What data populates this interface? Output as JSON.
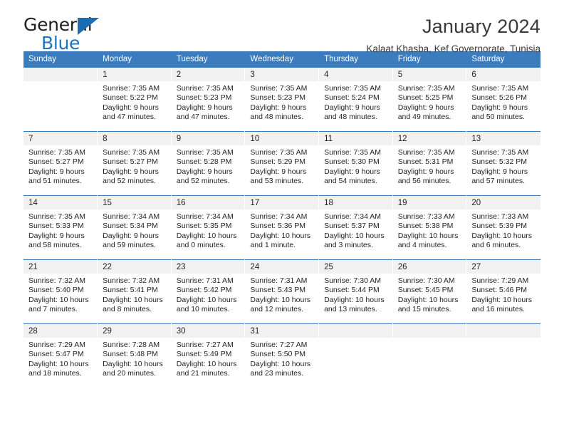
{
  "brand": {
    "name_line1": "General",
    "name_line2": "Blue",
    "triangle_color": "#1b6cb0",
    "blue_text_color": "#1b74bc"
  },
  "header": {
    "title": "January 2024",
    "subtitle": "Kalaat Khasba, Kef Governorate, Tunisia"
  },
  "theme": {
    "header_blue": "#3a7cbe",
    "daynum_band": "#f1f1f1",
    "text": "#231f20"
  },
  "columns": [
    "Sunday",
    "Monday",
    "Tuesday",
    "Wednesday",
    "Thursday",
    "Friday",
    "Saturday"
  ],
  "labels": {
    "sunrise_prefix": "Sunrise:",
    "sunset_prefix": "Sunset:",
    "daylight_prefix": "Daylight:"
  },
  "weeks": [
    [
      {
        "day": "",
        "sunrise": "",
        "sunset": "",
        "daylight_line1": "",
        "daylight_line2": ""
      },
      {
        "day": "1",
        "sunrise": "Sunrise: 7:35 AM",
        "sunset": "Sunset: 5:22 PM",
        "daylight_line1": "Daylight: 9 hours",
        "daylight_line2": "and 47 minutes."
      },
      {
        "day": "2",
        "sunrise": "Sunrise: 7:35 AM",
        "sunset": "Sunset: 5:23 PM",
        "daylight_line1": "Daylight: 9 hours",
        "daylight_line2": "and 47 minutes."
      },
      {
        "day": "3",
        "sunrise": "Sunrise: 7:35 AM",
        "sunset": "Sunset: 5:23 PM",
        "daylight_line1": "Daylight: 9 hours",
        "daylight_line2": "and 48 minutes."
      },
      {
        "day": "4",
        "sunrise": "Sunrise: 7:35 AM",
        "sunset": "Sunset: 5:24 PM",
        "daylight_line1": "Daylight: 9 hours",
        "daylight_line2": "and 48 minutes."
      },
      {
        "day": "5",
        "sunrise": "Sunrise: 7:35 AM",
        "sunset": "Sunset: 5:25 PM",
        "daylight_line1": "Daylight: 9 hours",
        "daylight_line2": "and 49 minutes."
      },
      {
        "day": "6",
        "sunrise": "Sunrise: 7:35 AM",
        "sunset": "Sunset: 5:26 PM",
        "daylight_line1": "Daylight: 9 hours",
        "daylight_line2": "and 50 minutes."
      }
    ],
    [
      {
        "day": "7",
        "sunrise": "Sunrise: 7:35 AM",
        "sunset": "Sunset: 5:27 PM",
        "daylight_line1": "Daylight: 9 hours",
        "daylight_line2": "and 51 minutes."
      },
      {
        "day": "8",
        "sunrise": "Sunrise: 7:35 AM",
        "sunset": "Sunset: 5:27 PM",
        "daylight_line1": "Daylight: 9 hours",
        "daylight_line2": "and 52 minutes."
      },
      {
        "day": "9",
        "sunrise": "Sunrise: 7:35 AM",
        "sunset": "Sunset: 5:28 PM",
        "daylight_line1": "Daylight: 9 hours",
        "daylight_line2": "and 52 minutes."
      },
      {
        "day": "10",
        "sunrise": "Sunrise: 7:35 AM",
        "sunset": "Sunset: 5:29 PM",
        "daylight_line1": "Daylight: 9 hours",
        "daylight_line2": "and 53 minutes."
      },
      {
        "day": "11",
        "sunrise": "Sunrise: 7:35 AM",
        "sunset": "Sunset: 5:30 PM",
        "daylight_line1": "Daylight: 9 hours",
        "daylight_line2": "and 54 minutes."
      },
      {
        "day": "12",
        "sunrise": "Sunrise: 7:35 AM",
        "sunset": "Sunset: 5:31 PM",
        "daylight_line1": "Daylight: 9 hours",
        "daylight_line2": "and 56 minutes."
      },
      {
        "day": "13",
        "sunrise": "Sunrise: 7:35 AM",
        "sunset": "Sunset: 5:32 PM",
        "daylight_line1": "Daylight: 9 hours",
        "daylight_line2": "and 57 minutes."
      }
    ],
    [
      {
        "day": "14",
        "sunrise": "Sunrise: 7:35 AM",
        "sunset": "Sunset: 5:33 PM",
        "daylight_line1": "Daylight: 9 hours",
        "daylight_line2": "and 58 minutes."
      },
      {
        "day": "15",
        "sunrise": "Sunrise: 7:34 AM",
        "sunset": "Sunset: 5:34 PM",
        "daylight_line1": "Daylight: 9 hours",
        "daylight_line2": "and 59 minutes."
      },
      {
        "day": "16",
        "sunrise": "Sunrise: 7:34 AM",
        "sunset": "Sunset: 5:35 PM",
        "daylight_line1": "Daylight: 10 hours",
        "daylight_line2": "and 0 minutes."
      },
      {
        "day": "17",
        "sunrise": "Sunrise: 7:34 AM",
        "sunset": "Sunset: 5:36 PM",
        "daylight_line1": "Daylight: 10 hours",
        "daylight_line2": "and 1 minute."
      },
      {
        "day": "18",
        "sunrise": "Sunrise: 7:34 AM",
        "sunset": "Sunset: 5:37 PM",
        "daylight_line1": "Daylight: 10 hours",
        "daylight_line2": "and 3 minutes."
      },
      {
        "day": "19",
        "sunrise": "Sunrise: 7:33 AM",
        "sunset": "Sunset: 5:38 PM",
        "daylight_line1": "Daylight: 10 hours",
        "daylight_line2": "and 4 minutes."
      },
      {
        "day": "20",
        "sunrise": "Sunrise: 7:33 AM",
        "sunset": "Sunset: 5:39 PM",
        "daylight_line1": "Daylight: 10 hours",
        "daylight_line2": "and 6 minutes."
      }
    ],
    [
      {
        "day": "21",
        "sunrise": "Sunrise: 7:32 AM",
        "sunset": "Sunset: 5:40 PM",
        "daylight_line1": "Daylight: 10 hours",
        "daylight_line2": "and 7 minutes."
      },
      {
        "day": "22",
        "sunrise": "Sunrise: 7:32 AM",
        "sunset": "Sunset: 5:41 PM",
        "daylight_line1": "Daylight: 10 hours",
        "daylight_line2": "and 8 minutes."
      },
      {
        "day": "23",
        "sunrise": "Sunrise: 7:31 AM",
        "sunset": "Sunset: 5:42 PM",
        "daylight_line1": "Daylight: 10 hours",
        "daylight_line2": "and 10 minutes."
      },
      {
        "day": "24",
        "sunrise": "Sunrise: 7:31 AM",
        "sunset": "Sunset: 5:43 PM",
        "daylight_line1": "Daylight: 10 hours",
        "daylight_line2": "and 12 minutes."
      },
      {
        "day": "25",
        "sunrise": "Sunrise: 7:30 AM",
        "sunset": "Sunset: 5:44 PM",
        "daylight_line1": "Daylight: 10 hours",
        "daylight_line2": "and 13 minutes."
      },
      {
        "day": "26",
        "sunrise": "Sunrise: 7:30 AM",
        "sunset": "Sunset: 5:45 PM",
        "daylight_line1": "Daylight: 10 hours",
        "daylight_line2": "and 15 minutes."
      },
      {
        "day": "27",
        "sunrise": "Sunrise: 7:29 AM",
        "sunset": "Sunset: 5:46 PM",
        "daylight_line1": "Daylight: 10 hours",
        "daylight_line2": "and 16 minutes."
      }
    ],
    [
      {
        "day": "28",
        "sunrise": "Sunrise: 7:29 AM",
        "sunset": "Sunset: 5:47 PM",
        "daylight_line1": "Daylight: 10 hours",
        "daylight_line2": "and 18 minutes."
      },
      {
        "day": "29",
        "sunrise": "Sunrise: 7:28 AM",
        "sunset": "Sunset: 5:48 PM",
        "daylight_line1": "Daylight: 10 hours",
        "daylight_line2": "and 20 minutes."
      },
      {
        "day": "30",
        "sunrise": "Sunrise: 7:27 AM",
        "sunset": "Sunset: 5:49 PM",
        "daylight_line1": "Daylight: 10 hours",
        "daylight_line2": "and 21 minutes."
      },
      {
        "day": "31",
        "sunrise": "Sunrise: 7:27 AM",
        "sunset": "Sunset: 5:50 PM",
        "daylight_line1": "Daylight: 10 hours",
        "daylight_line2": "and 23 minutes."
      },
      {
        "day": "",
        "sunrise": "",
        "sunset": "",
        "daylight_line1": "",
        "daylight_line2": ""
      },
      {
        "day": "",
        "sunrise": "",
        "sunset": "",
        "daylight_line1": "",
        "daylight_line2": ""
      },
      {
        "day": "",
        "sunrise": "",
        "sunset": "",
        "daylight_line1": "",
        "daylight_line2": ""
      }
    ]
  ]
}
